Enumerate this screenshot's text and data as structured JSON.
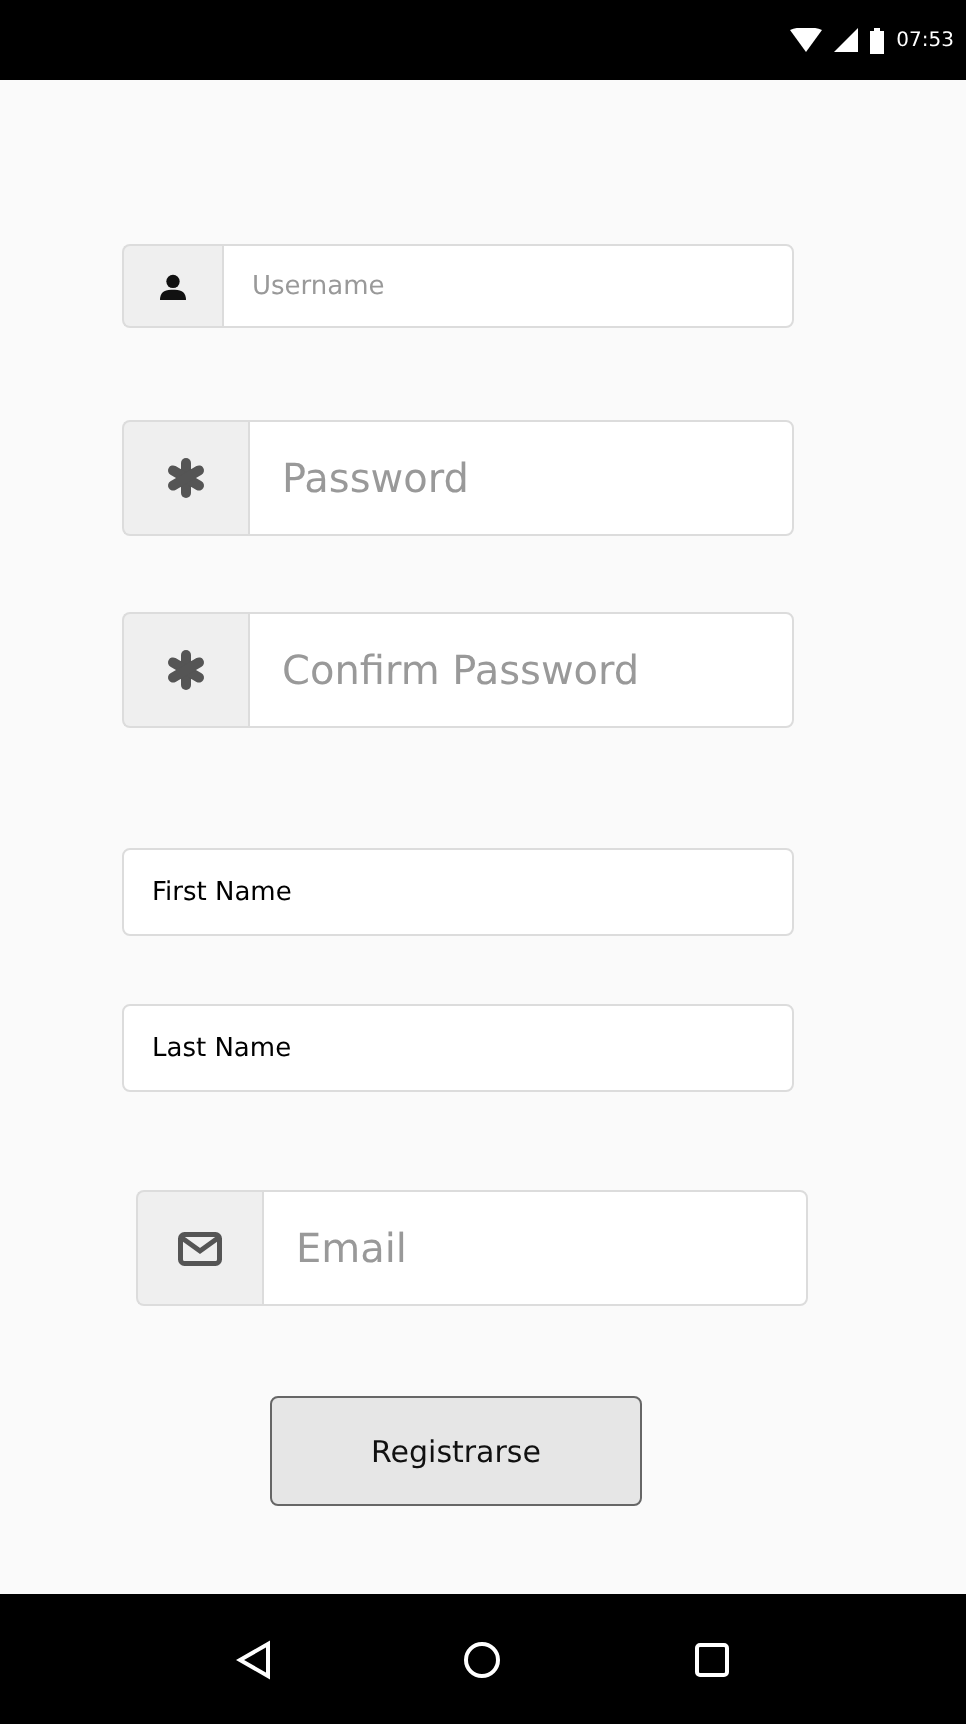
{
  "status_bar": {
    "time": "07:53"
  },
  "fields": [
    {
      "kind": "person",
      "placeholder": "Username"
    },
    {
      "kind": "secret",
      "placeholder": "Password"
    },
    {
      "kind": "secret",
      "placeholder": "Confirm Password"
    },
    {
      "kind": "plain",
      "value": "First Name"
    },
    {
      "kind": "plain",
      "value": "Last Name"
    },
    {
      "kind": "mail",
      "placeholder": "Email"
    }
  ],
  "button": "Registrarse"
}
